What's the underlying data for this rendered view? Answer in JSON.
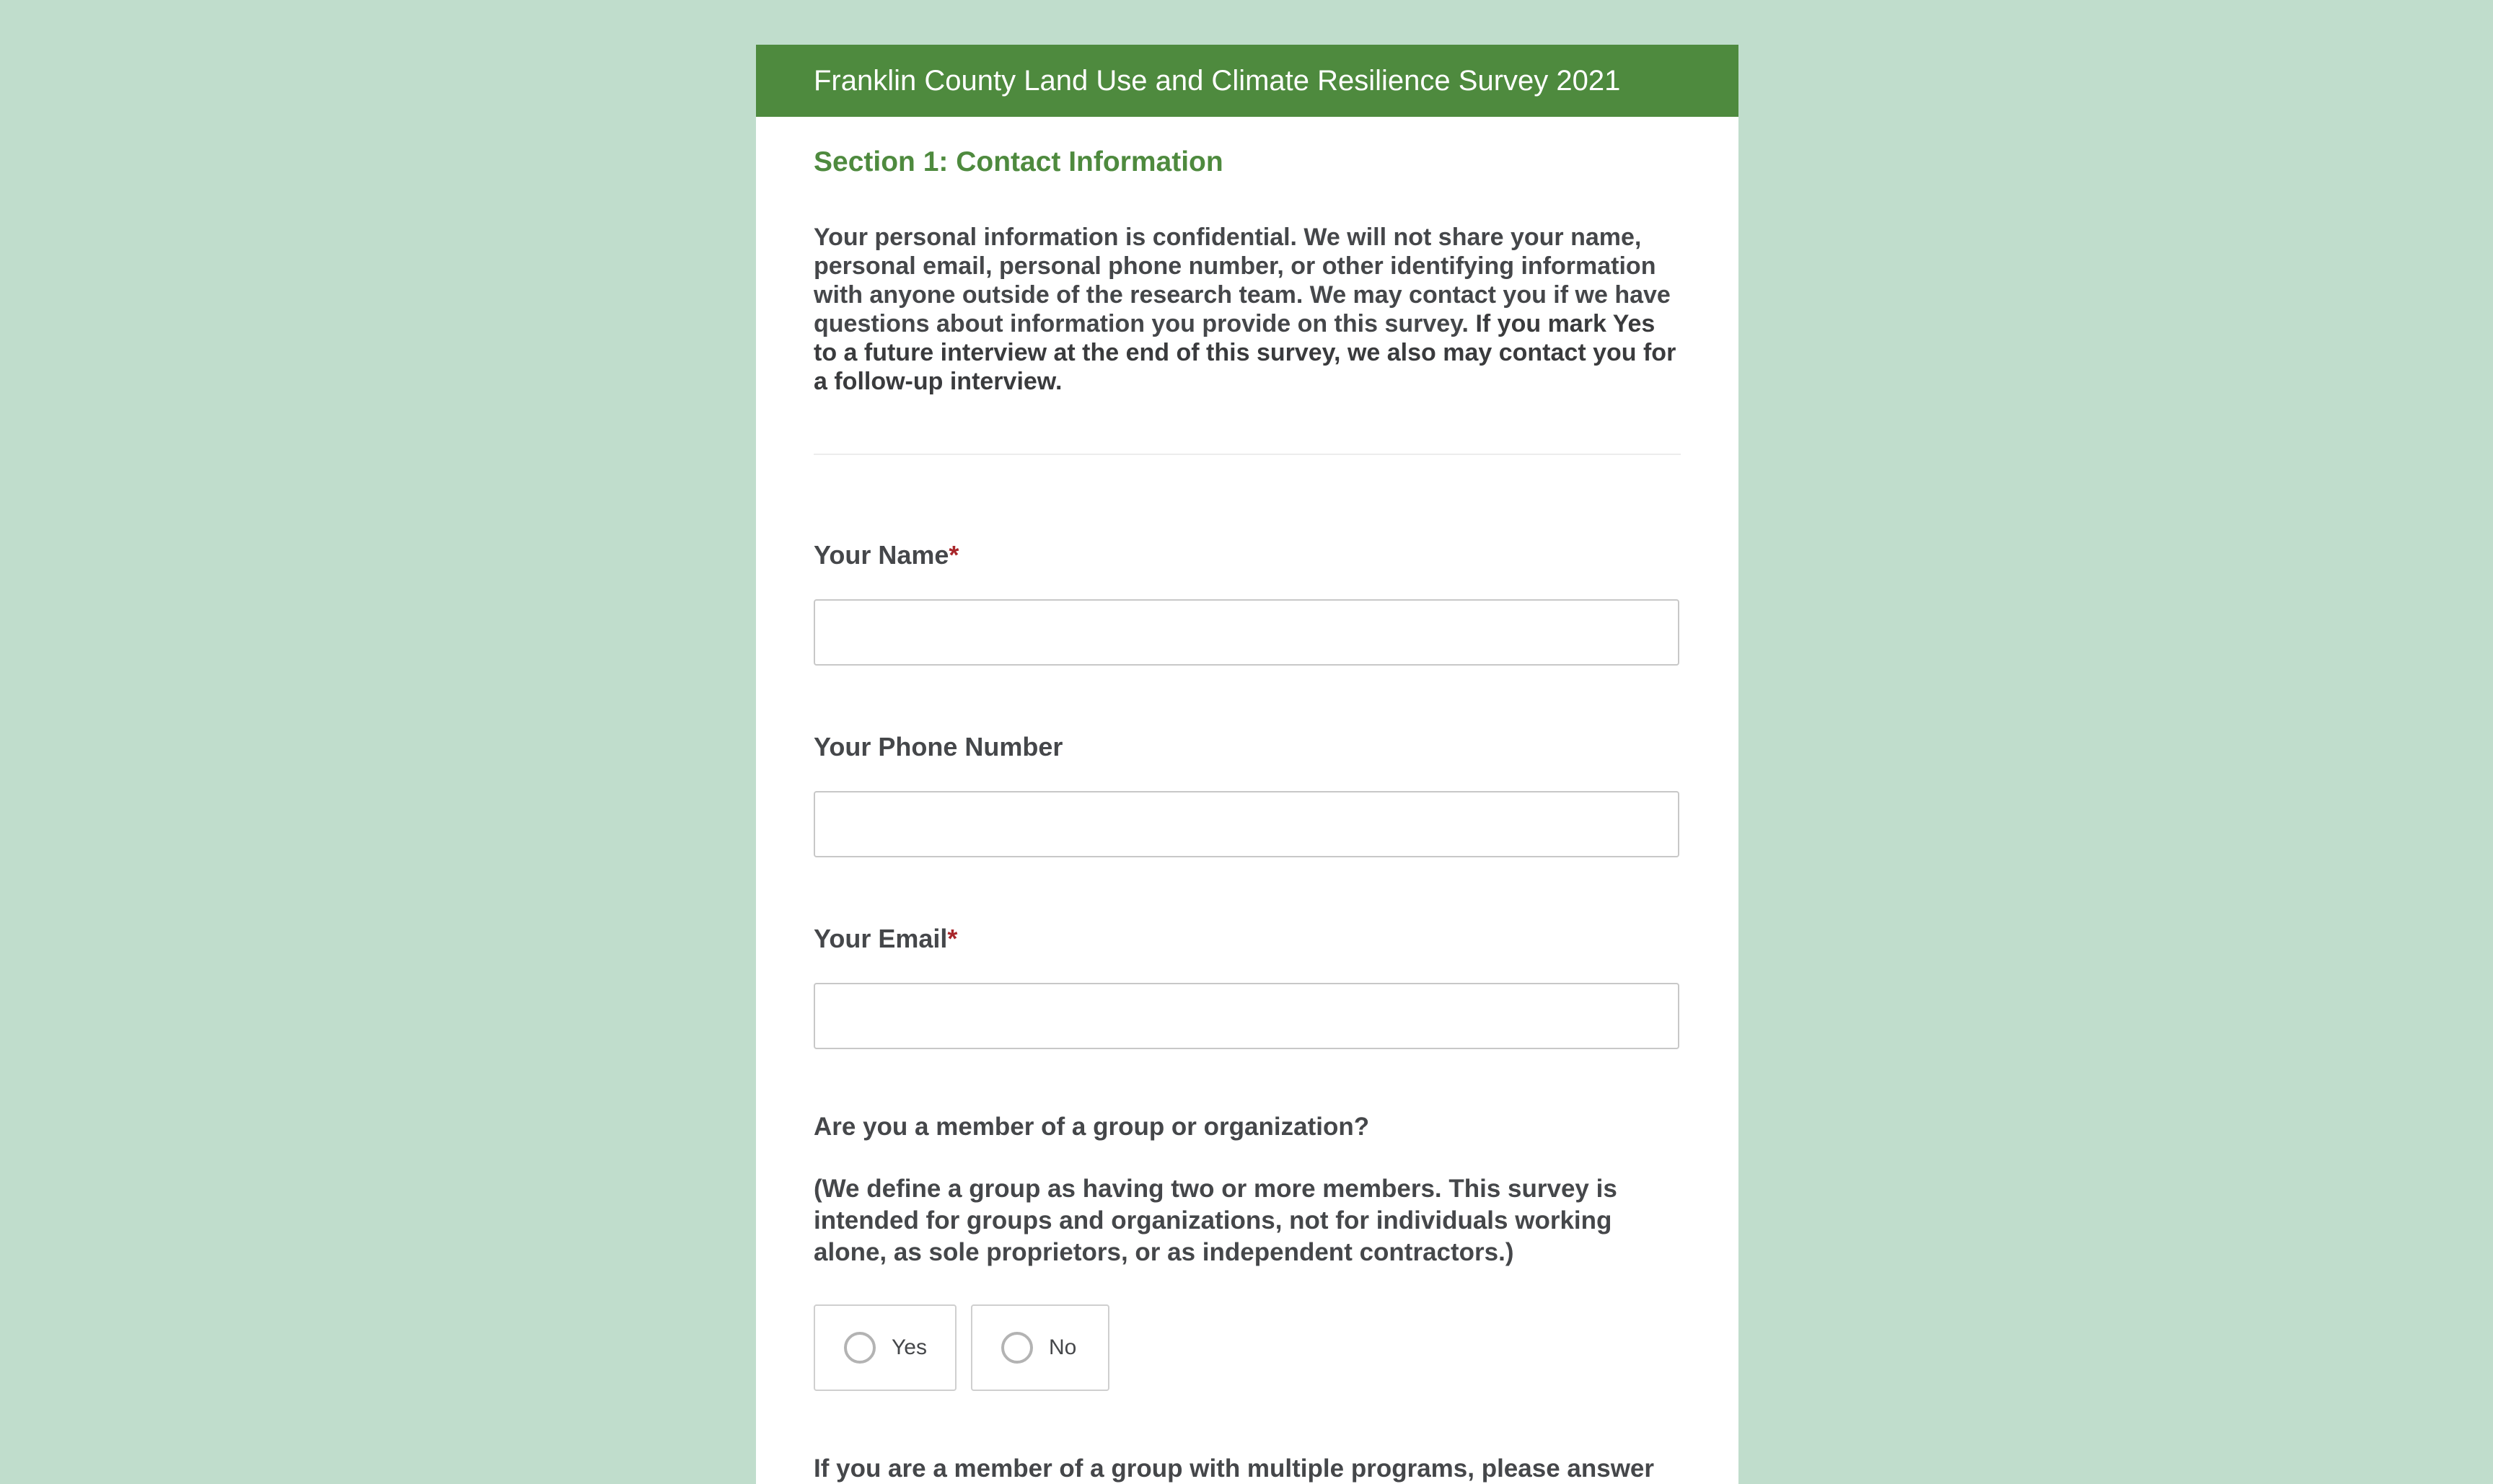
{
  "header": {
    "title": "Franklin County Land Use and Climate Resilience Survey 2021"
  },
  "section": {
    "title": "Section 1: Contact Information"
  },
  "intro": {
    "text": "Your personal information is confidential. We will not share your name, personal email, personal phone number, or other identifying information with anyone outside of the research team. We may contact you if we have questions about information you provide on this survey.",
    "emphasis": "If you mark Yes to a future interview at the end of this survey, we also may contact you for a follow-up interview."
  },
  "fields": {
    "name": {
      "label": "Your Name",
      "required_mark": "*",
      "value": "",
      "placeholder": ""
    },
    "phone": {
      "label": "Your Phone Number",
      "value": "",
      "placeholder": ""
    },
    "email": {
      "label": "Your Email",
      "required_mark": "*",
      "value": "",
      "placeholder": ""
    }
  },
  "group_question": {
    "label": "Are you a member of a group or organization?",
    "note": "(We define a group as having two or more members. This survey is intended for groups and organizations, not for individuals working alone, as sole proprietors, or as independent contractors.)",
    "options": [
      {
        "label": "Yes",
        "selected": false
      },
      {
        "label": "No",
        "selected": false
      }
    ]
  },
  "next_question": {
    "label_partial": "If you are a member of a group with multiple programs, please answer"
  },
  "colors": {
    "background": "#c0ddcc",
    "header": "#4e8a3e",
    "accent": "#4e8a3e",
    "required": "#a8262a",
    "text": "#45474a"
  }
}
